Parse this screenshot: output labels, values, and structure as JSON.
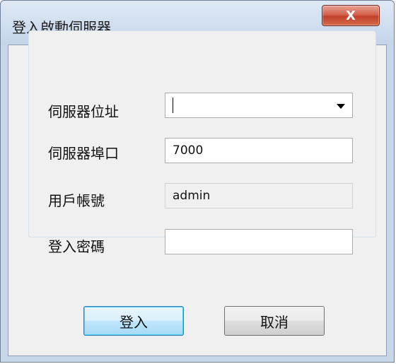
{
  "window": {
    "title": "登入啟動伺服器",
    "close_label": "X"
  },
  "form": {
    "server_address": {
      "label": "伺服器位址",
      "value": ""
    },
    "server_port": {
      "label": "伺服器埠口",
      "value": "7000"
    },
    "username": {
      "label": "用戶帳號",
      "value": "admin"
    },
    "password": {
      "label": "登入密碼",
      "value": ""
    }
  },
  "buttons": {
    "login": "登入",
    "cancel": "取消"
  }
}
